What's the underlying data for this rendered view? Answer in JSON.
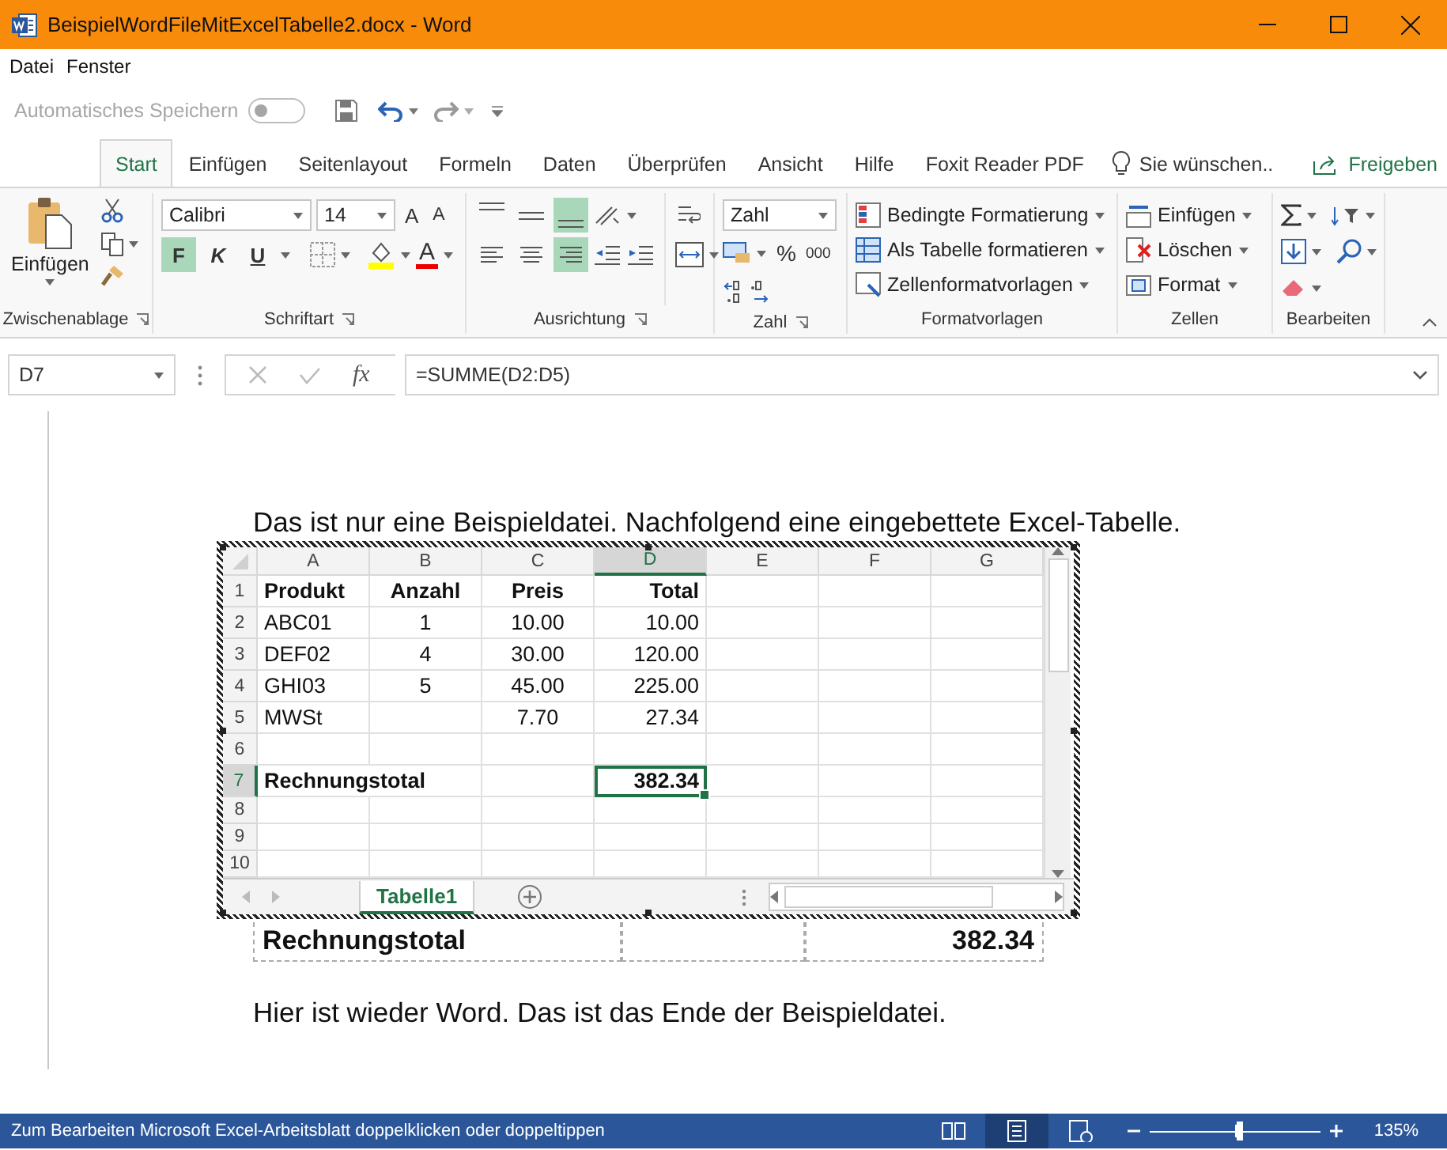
{
  "window": {
    "title": "BeispielWordFileMitExcelTabelle2.docx - Word"
  },
  "menu": [
    "Datei",
    "Fenster"
  ],
  "quick_access": {
    "autosave_label": "Automatisches Speichern",
    "autosave_on": false
  },
  "ribbon_tabs": [
    {
      "label": "Start",
      "selected": true
    },
    {
      "label": "Einfügen",
      "selected": false
    },
    {
      "label": "Seitenlayout",
      "selected": false
    },
    {
      "label": "Formeln",
      "selected": false
    },
    {
      "label": "Daten",
      "selected": false
    },
    {
      "label": "Überprüfen",
      "selected": false
    },
    {
      "label": "Ansicht",
      "selected": false
    },
    {
      "label": "Hilfe",
      "selected": false
    },
    {
      "label": "Foxit Reader PDF",
      "selected": false
    }
  ],
  "tell_me": "Sie wünschen..",
  "share": "Freigeben",
  "ribbon": {
    "clipboard": {
      "paste": "Einfügen",
      "group": "Zwischenablage"
    },
    "font": {
      "name": "Calibri",
      "size": "14",
      "grow": "A",
      "shrink": "A",
      "styles": [
        {
          "label": "F",
          "selected": true
        },
        {
          "label": "K",
          "selected": false
        },
        {
          "label": "U",
          "selected": false
        }
      ],
      "color_label": "A",
      "group": "Schriftart"
    },
    "alignment": {
      "vertical": [
        {
          "selected": false
        },
        {
          "selected": false
        },
        {
          "selected": true
        }
      ],
      "horizontal": [
        {
          "selected": false
        },
        {
          "selected": false
        },
        {
          "selected": true
        }
      ],
      "group": "Ausrichtung"
    },
    "number": {
      "format": "Zahl",
      "percent": "%",
      "thousands": "000",
      "group": "Zahl"
    },
    "styles": {
      "items": [
        "Bedingte Formatierung",
        "Als Tabelle formatieren",
        "Zellenformatvorlagen"
      ],
      "group": "Formatvorlagen"
    },
    "cells": {
      "items": [
        "Einfügen",
        "Löschen",
        "Format"
      ],
      "group": "Zellen"
    },
    "editing": {
      "group": "Bearbeiten"
    }
  },
  "formula_bar": {
    "name_box": "D7",
    "function_label": "fx",
    "formula": "=SUMME(D2:D5)"
  },
  "document": {
    "intro": "Das ist nur eine Beispieldatei. Nachfolgend eine eingebettete Excel-Tabelle.",
    "excel": {
      "columns": [
        {
          "label": "A",
          "selected": false
        },
        {
          "label": "B",
          "selected": false
        },
        {
          "label": "C",
          "selected": false
        },
        {
          "label": "D",
          "selected": true
        },
        {
          "label": "E",
          "selected": false
        },
        {
          "label": "F",
          "selected": false
        },
        {
          "label": "G",
          "selected": false
        }
      ],
      "rows": [
        {
          "label": "1",
          "selected": false,
          "bold": true,
          "cells": {
            "A": "Produkt",
            "B": "Anzahl",
            "C": "Preis",
            "D": "Total"
          }
        },
        {
          "label": "2",
          "selected": false,
          "bold": false,
          "cells": {
            "A": "ABC01",
            "B": "1",
            "C": "10.00",
            "D": "10.00"
          }
        },
        {
          "label": "3",
          "selected": false,
          "bold": false,
          "cells": {
            "A": "DEF02",
            "B": "4",
            "C": "30.00",
            "D": "120.00"
          }
        },
        {
          "label": "4",
          "selected": false,
          "bold": false,
          "cells": {
            "A": "GHI03",
            "B": "5",
            "C": "45.00",
            "D": "225.00"
          }
        },
        {
          "label": "5",
          "selected": false,
          "bold": false,
          "cells": {
            "A": "MWSt",
            "C": "7.70",
            "D": "27.34"
          }
        },
        {
          "label": "6",
          "selected": false,
          "bold": false
        },
        {
          "label": "7",
          "selected": true,
          "bold": true,
          "cells": {
            "A": "Rechnungstotal",
            "D": "382.34"
          }
        },
        {
          "label": "8",
          "selected": false,
          "bold": false
        },
        {
          "label": "9",
          "selected": false,
          "bold": false
        },
        {
          "label": "10",
          "selected": false,
          "bold": false
        }
      ],
      "sheet_tabs": [
        {
          "label": "Tabelle1",
          "selected": true
        }
      ]
    },
    "word_table": [
      "Rechnungstotal",
      "382.34"
    ],
    "outro": "Hier ist wieder Word. Das ist das Ende der Beispieldatei."
  },
  "status_bar": {
    "message": "Zum Bearbeiten Microsoft Excel-Arbeitsblatt doppelklicken oder doppeltippen",
    "views": [
      {
        "selected": false
      },
      {
        "selected": true
      },
      {
        "selected": false
      }
    ],
    "zoom_slider": {
      "level": 0.53
    },
    "zoom": "135%"
  }
}
